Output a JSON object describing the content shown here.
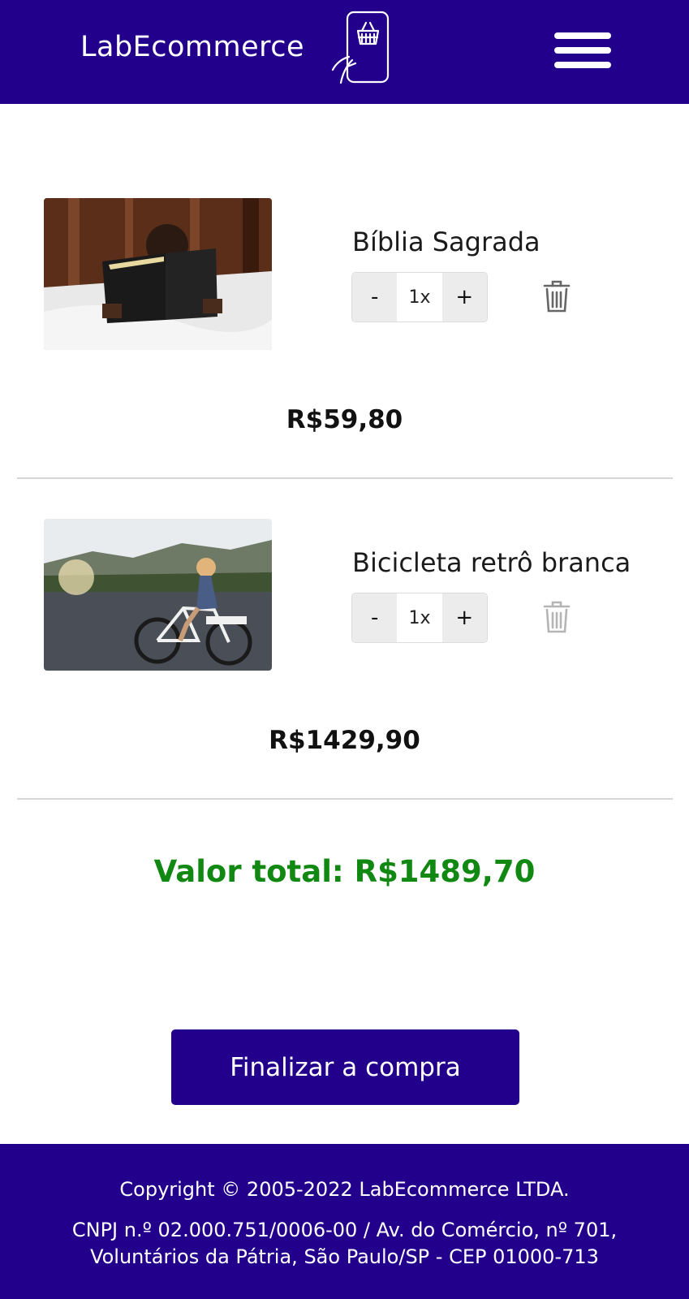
{
  "header": {
    "logo_text": "LabEcommerce",
    "logo_icon": "phone-basket-icon",
    "menu_icon": "hamburger-menu-icon"
  },
  "cart": {
    "items": [
      {
        "name": "Bíblia Sagrada",
        "image": "person-reading-bible-photo",
        "decrement_label": "-",
        "quantity": "1x",
        "increment_label": "+",
        "delete_icon": "trash-icon",
        "price": "R$59,80"
      },
      {
        "name": "Bicicleta retrô branca",
        "image": "woman-on-white-bicycle-photo",
        "decrement_label": "-",
        "quantity": "1x",
        "increment_label": "+",
        "delete_icon": "trash-icon",
        "price": "R$1429,90"
      }
    ],
    "total_label": "Valor total: R$1489,70",
    "checkout_label": "Finalizar a compra"
  },
  "footer": {
    "copyright": "Copyright © 2005-2022 LabEcommerce LTDA.",
    "address": "CNPJ n.º 02.000.751/0006-00 / Av. do Comércio, nº 701, Voluntários da Pátria, São Paulo/SP - CEP 01000-713"
  },
  "colors": {
    "brand": "#23008c",
    "total_green": "#118811",
    "background": "#ffffff"
  }
}
